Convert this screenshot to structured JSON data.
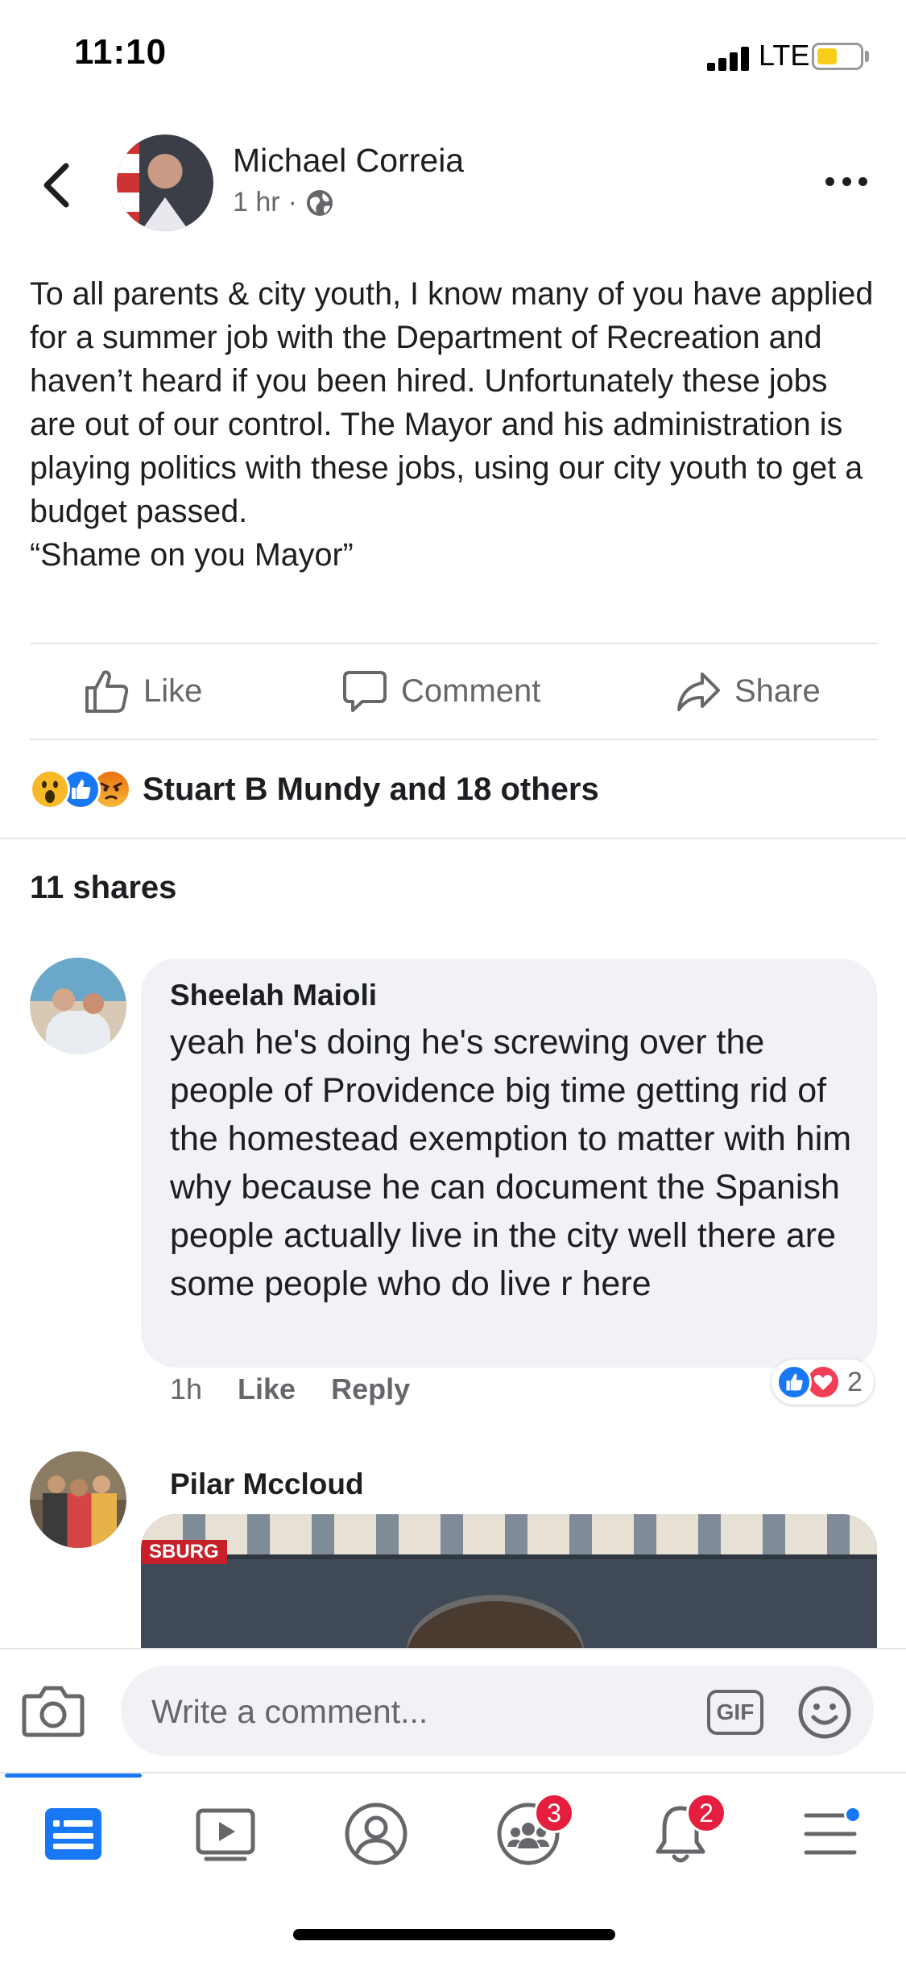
{
  "status_bar": {
    "time": "11:10",
    "network": "LTE",
    "battery_color": "#f7cf1b"
  },
  "post": {
    "author": "Michael Correia",
    "time": "1 hr",
    "separator": "·",
    "privacy_icon": "globe-icon",
    "text": "To all parents & city youth, I know many of you have applied for a summer job with the Department of Recreation and haven’t heard if you been hired. Unfortunately these jobs are out of our control. The Mayor and his administration is playing politics with these jobs, using our city youth to get a budget passed.\n“Shame on you Mayor”"
  },
  "actions": {
    "like": "Like",
    "comment": "Comment",
    "share": "Share"
  },
  "reactions": {
    "icons": [
      "wow-reaction-icon",
      "like-reaction-icon",
      "angry-reaction-icon"
    ],
    "summary": "Stuart B Mundy and 18 others"
  },
  "shares": {
    "label": "11 shares"
  },
  "comments": [
    {
      "author": "Sheelah Maioli",
      "text": "yeah he's doing he's screwing over the people of Providence big time getting rid of the homestead exemption to matter with him why because he can document the Spanish people actually live in the city well there are some people who do live r here",
      "time": "1h",
      "like_label": "Like",
      "reply_label": "Reply",
      "reaction_count": "2",
      "reaction_icons": [
        "like-reaction-icon",
        "love-reaction-icon"
      ]
    },
    {
      "author": "Pilar Mccloud",
      "image_tag": "SBURG"
    }
  ],
  "composer": {
    "placeholder": "Write a comment...",
    "gif_label": "GIF"
  },
  "tabs": [
    {
      "name": "news-feed",
      "badge": ""
    },
    {
      "name": "watch",
      "badge": ""
    },
    {
      "name": "profile",
      "badge": ""
    },
    {
      "name": "groups",
      "badge": "3"
    },
    {
      "name": "notifications",
      "badge": "2"
    },
    {
      "name": "menu",
      "badge": ""
    }
  ],
  "colors": {
    "accent": "#1877f2",
    "badge": "#e41e3f",
    "secondary_text": "#65676b"
  }
}
